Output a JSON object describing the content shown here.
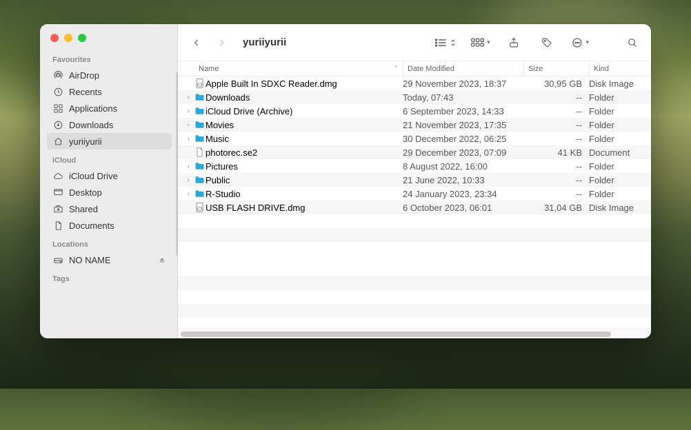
{
  "window_title": "yuriiyurii",
  "sidebar": {
    "sections": [
      {
        "title": "Favourites",
        "items": [
          {
            "icon": "airdrop",
            "label": "AirDrop"
          },
          {
            "icon": "clock",
            "label": "Recents"
          },
          {
            "icon": "apps",
            "label": "Applications"
          },
          {
            "icon": "download",
            "label": "Downloads"
          },
          {
            "icon": "home",
            "label": "yuriiyurii",
            "active": true
          }
        ]
      },
      {
        "title": "iCloud",
        "items": [
          {
            "icon": "cloud",
            "label": "iCloud Drive"
          },
          {
            "icon": "desktop",
            "label": "Desktop"
          },
          {
            "icon": "shared",
            "label": "Shared"
          },
          {
            "icon": "doc",
            "label": "Documents"
          }
        ]
      },
      {
        "title": "Locations",
        "items": [
          {
            "icon": "drive",
            "label": "NO NAME",
            "eject": true
          }
        ]
      },
      {
        "title": "Tags",
        "items": []
      }
    ]
  },
  "columns": {
    "name": "Name",
    "date": "Date Modified",
    "size": "Size",
    "kind": "Kind"
  },
  "files": [
    {
      "disclose": false,
      "type": "dmg",
      "name": "Apple Built In SDXC Reader.dmg",
      "date": "29 November 2023, 18:37",
      "size": "30,95 GB",
      "kind": "Disk Image"
    },
    {
      "disclose": true,
      "type": "folder",
      "name": "Downloads",
      "date": "Today, 07:43",
      "size": "--",
      "kind": "Folder"
    },
    {
      "disclose": true,
      "type": "folder",
      "name": "iCloud Drive (Archive)",
      "date": "6 September 2023, 14:33",
      "size": "--",
      "kind": "Folder"
    },
    {
      "disclose": true,
      "type": "folder",
      "name": "Movies",
      "date": "21 November 2023, 17:35",
      "size": "--",
      "kind": "Folder"
    },
    {
      "disclose": true,
      "type": "folder",
      "name": "Music",
      "date": "30 December 2022, 06:25",
      "size": "--",
      "kind": "Folder"
    },
    {
      "disclose": false,
      "type": "doc",
      "name": "photorec.se2",
      "date": "29 December 2023, 07:09",
      "size": "41 KB",
      "kind": "Document"
    },
    {
      "disclose": true,
      "type": "folder",
      "name": "Pictures",
      "date": "8 August 2022, 16:00",
      "size": "--",
      "kind": "Folder"
    },
    {
      "disclose": true,
      "type": "folder",
      "name": "Public",
      "date": "21 June 2022, 10:33",
      "size": "--",
      "kind": "Folder"
    },
    {
      "disclose": true,
      "type": "folder",
      "name": "R-Studio",
      "date": "24 January 2023, 23:34",
      "size": "--",
      "kind": "Folder"
    },
    {
      "disclose": false,
      "type": "dmg",
      "name": "USB FLASH DRIVE.dmg",
      "date": "6 October 2023, 06:01",
      "size": "31,04 GB",
      "kind": "Disk Image"
    }
  ]
}
